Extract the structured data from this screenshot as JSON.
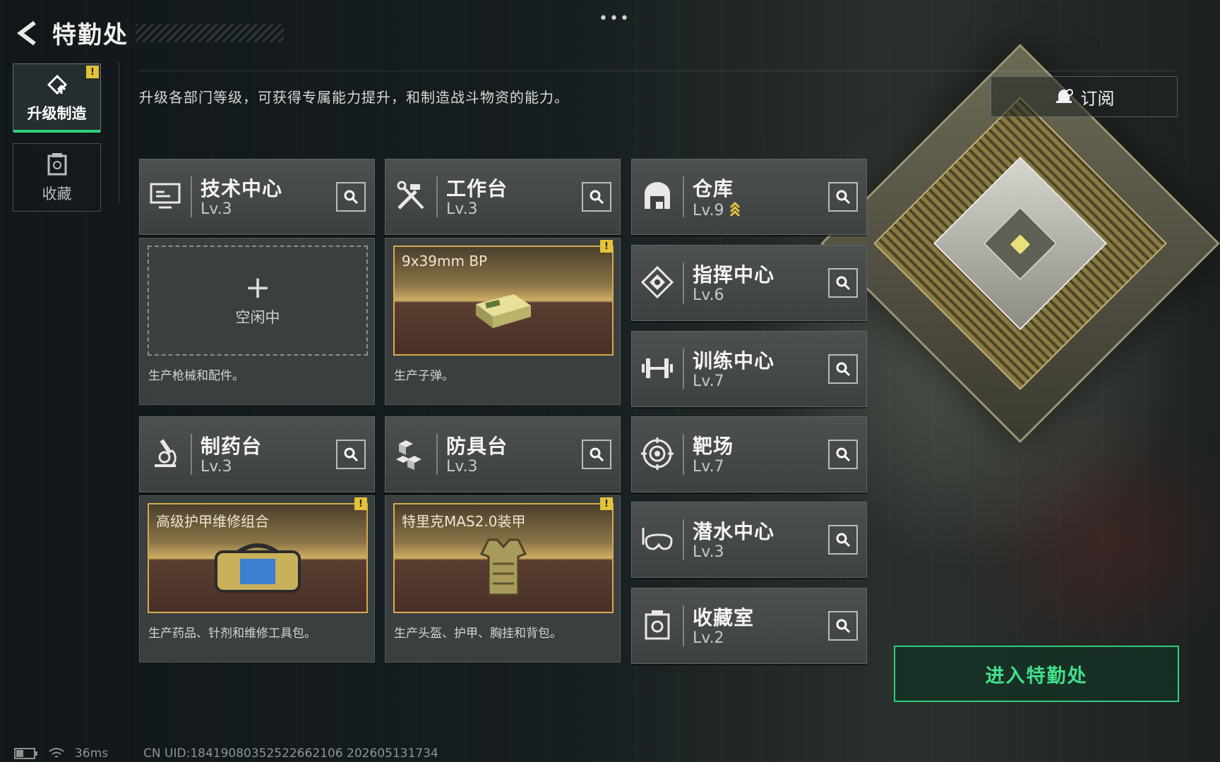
{
  "header": {
    "title": "特勤处",
    "more_dots": "•••"
  },
  "sidebar": {
    "items": [
      {
        "label": "升级制造",
        "badge": "!"
      },
      {
        "label": "收藏"
      }
    ]
  },
  "description": "升级各部门等级，可获得专属能力提升，和制造战斗物资的能力。",
  "subscribe_label": "订阅",
  "production_cards": [
    {
      "name": "技术中心",
      "level": "Lv.3",
      "status": "空闲中",
      "item": "",
      "desc": "生产枪械和配件。"
    },
    {
      "name": "工作台",
      "level": "Lv.3",
      "item": "9x39mm BP",
      "badge": "!",
      "desc": "生产子弹。"
    },
    {
      "name": "制药台",
      "level": "Lv.3",
      "item": "高级护甲维修组合",
      "badge": "!",
      "desc": "生产药品、针剂和维修工具包。"
    },
    {
      "name": "防具台",
      "level": "Lv.3",
      "item": "特里克MAS2.0装甲",
      "badge": "!",
      "desc": "生产头盔、护甲、胸挂和背包。"
    }
  ],
  "buildings": [
    {
      "name": "仓库",
      "level": "Lv.9",
      "upgrade": true,
      "icon": "warehouse-icon"
    },
    {
      "name": "指挥中心",
      "level": "Lv.6",
      "icon": "command-icon"
    },
    {
      "name": "训练中心",
      "level": "Lv.7",
      "icon": "dumbbell-icon"
    },
    {
      "name": "靶场",
      "level": "Lv.7",
      "icon": "target-icon"
    },
    {
      "name": "潜水中心",
      "level": "Lv.3",
      "icon": "diving-mask-icon"
    },
    {
      "name": "收藏室",
      "level": "Lv.2",
      "icon": "collection-icon"
    }
  ],
  "enter_button": "进入特勤处",
  "status_bar": {
    "ping": "36ms",
    "uid": "CN UID:18419080352522662106 202605131734"
  },
  "colors": {
    "accent_green": "#2fd07a",
    "warning_yellow": "#e4c33a",
    "item_frame": "#d6aa50"
  }
}
